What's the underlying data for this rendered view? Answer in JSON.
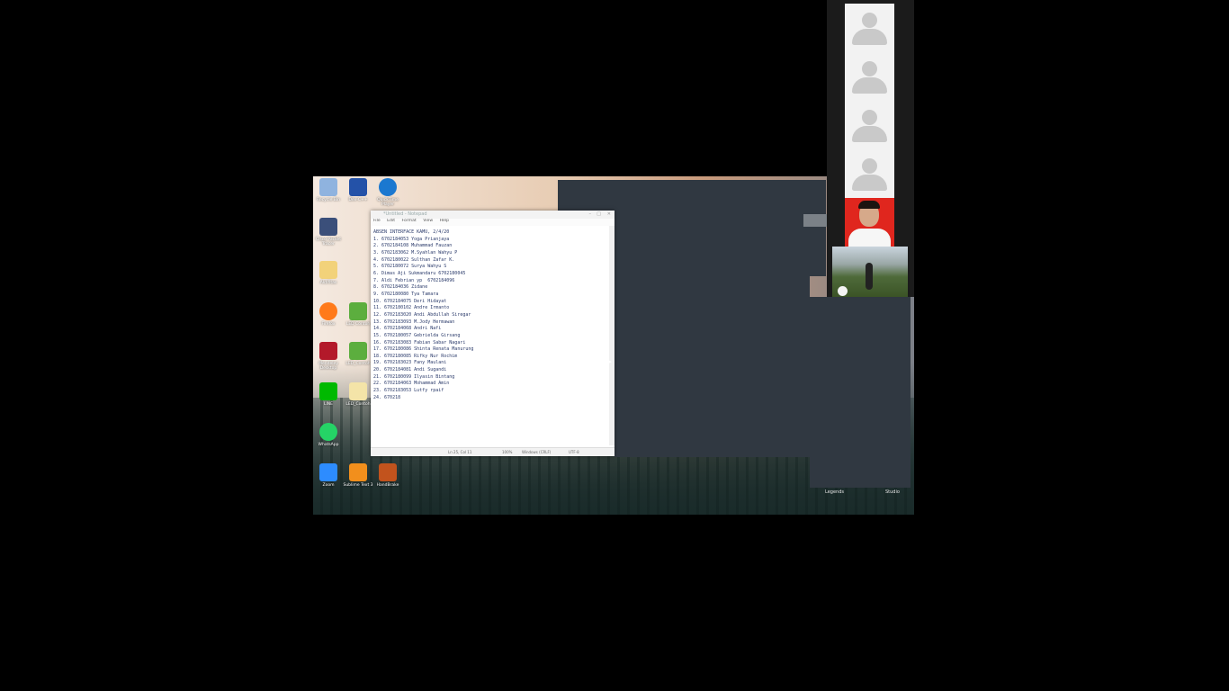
{
  "desktop": {
    "icons": [
      {
        "label": "Recycle Bin",
        "icon": "recycle-bin-icon",
        "color": "#7fa6d6"
      },
      {
        "label": "Dev-C++",
        "icon": "devcpp-icon",
        "color": "#2452a8"
      },
      {
        "label": "QuickTime Player",
        "icon": "quicktime-icon",
        "color": "#1b78d0"
      },
      {
        "label": "Cisco Packet Tracer",
        "icon": "packet-tracer-icon",
        "color": "#3b4f7a"
      },
      {
        "label": "Aktifitas",
        "icon": "folder-icon",
        "color": "#f2d27a"
      },
      {
        "label": "Firefox",
        "icon": "firefox-icon",
        "color": "#ff7a1a"
      },
      {
        "label": "LED Contoh",
        "icon": "script-icon",
        "color": "#5cae3e"
      },
      {
        "label": "Mendeley Desktop",
        "icon": "mendeley-icon",
        "color": "#b3192a"
      },
      {
        "label": "LED_Contoh",
        "icon": "script-icon",
        "color": "#5cae3e"
      },
      {
        "label": "LINE",
        "icon": "line-icon",
        "color": "#00b900"
      },
      {
        "label": "LED_Contoh",
        "icon": "file-icon",
        "color": "#f4e4a8"
      },
      {
        "label": "WhatsApp",
        "icon": "whatsapp-icon",
        "color": "#25d366"
      },
      {
        "label": "Zoom",
        "icon": "zoom-icon",
        "color": "#2d8cff"
      },
      {
        "label": "Sublime Text 3",
        "icon": "sublime-icon",
        "color": "#f28f1c"
      },
      {
        "label": "HandBrake",
        "icon": "handbrake-icon",
        "color": "#c2531d"
      }
    ]
  },
  "notepad": {
    "title": "*Untitled - Notepad",
    "menu": [
      "File",
      "Edit",
      "Format",
      "View",
      "Help"
    ],
    "lines": [
      "ABSEN INTERFACE KAMU, 2/4/20",
      "1. 6702184053 Yoga Prianjaya",
      "2. 6702184108 Muhammad Fauzan",
      "3. 6702183062 M.Syahlan Wahyu P",
      "4. 6702180022 Sulthan Zafar K.",
      "5. 6702180072 Surya Wahyu S",
      "6. Dimas Aji Sukmandaru 6702180045",
      "7. Aldi Febrian yp  6702184096",
      "8. 6702184036 Zidane",
      "9. 6702180080 Tya Tamara",
      "10. 6702184075 Deri Hidayat",
      "11. 6702180102 Andre Irmanto",
      "12. 6702183020 Andi Abdullah Siregar",
      "13. 6702183093 M.Jody Hermawan",
      "14. 6702184068 Andri Nafi",
      "15. 6702180057 Gebrielda Girsang",
      "16. 6702183083 Fabian Sabar Nagari",
      "17. 6702180086 Shinta Renata Manurung",
      "18. 6702180085 Rifky Nur Rochim",
      "19. 6702183023 Fany Maulani",
      "20. 6702184081 Andi Sugandi",
      "21. 6702180099 Ilyasin Bintang",
      "22. 6702184063 Mohammad Amin",
      "23. 6702183053 Lutfy rpaif",
      "24. 670218"
    ],
    "status": {
      "position": "Ln 25, Col 11",
      "zoom": "100%",
      "line_ending": "Windows (CRLF)",
      "encoding": "UTF-8"
    }
  },
  "meeting": {
    "participants_placeholder_count": 4,
    "bottom_left_label": "Legends",
    "bottom_right_label": "Studio"
  }
}
